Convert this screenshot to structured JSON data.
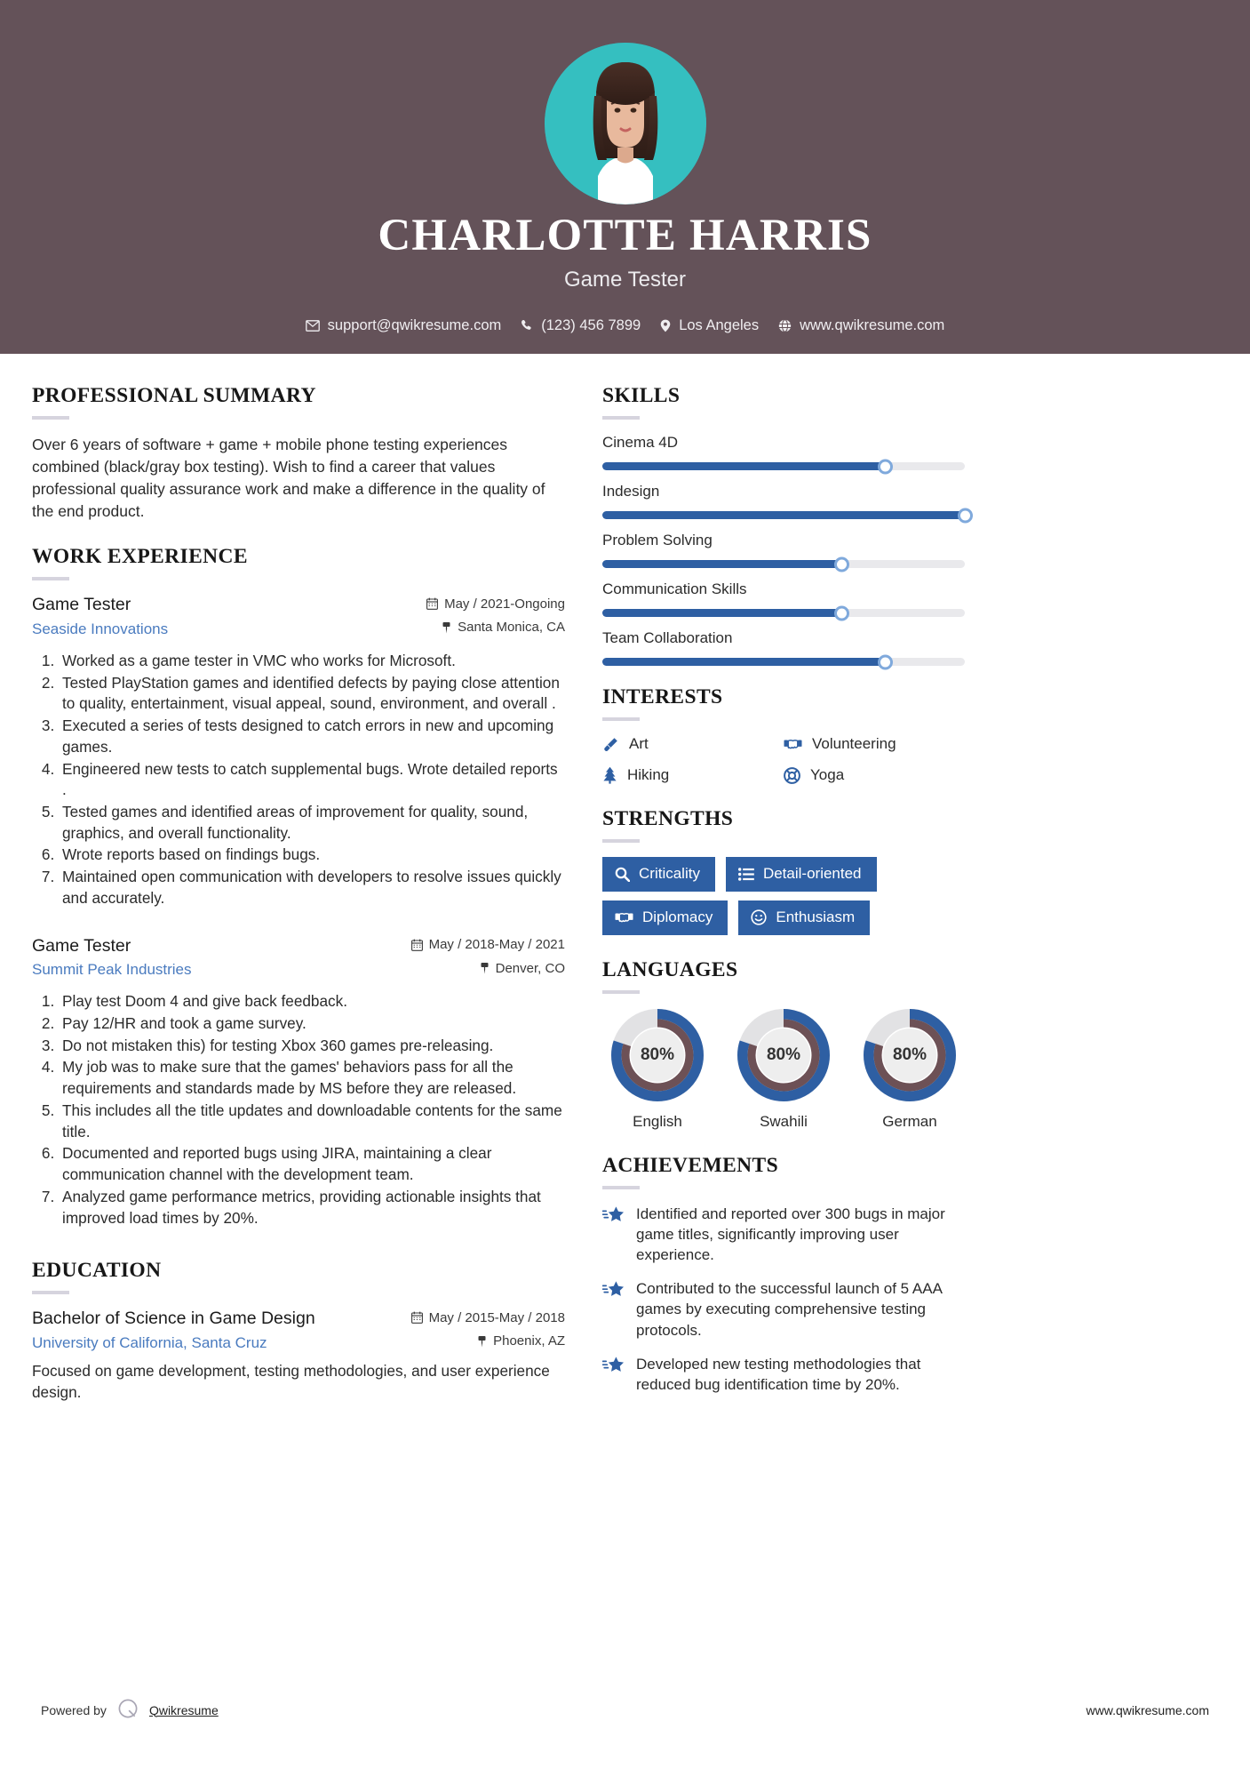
{
  "header": {
    "name": "CHARLOTTE HARRIS",
    "role": "Game Tester",
    "avatar_bg": "#35BFC0",
    "bg_color": "#645259",
    "contacts": [
      {
        "icon": "envelope-icon",
        "text": "support@qwikresume.com"
      },
      {
        "icon": "phone-icon",
        "text": "(123) 456 7899"
      },
      {
        "icon": "location-pin-icon",
        "text": "Los Angeles"
      },
      {
        "icon": "globe-icon",
        "text": "www.qwikresume.com"
      }
    ]
  },
  "summary": {
    "title": "PROFESSIONAL SUMMARY",
    "text": "Over 6 years of software + game + mobile phone testing experiences combined (black/gray box testing). Wish to find a career that values professional quality assurance work and make a difference in the quality of the end product."
  },
  "work": {
    "title": "WORK EXPERIENCE",
    "jobs": [
      {
        "title": "Game Tester",
        "org": "Seaside Innovations",
        "dates": "May / 2021-Ongoing",
        "location": "Santa Monica, CA",
        "bullets": [
          "Worked as a game tester in VMC who works for Microsoft.",
          "Tested PlayStation games and identified defects by paying close attention to quality, entertainment, visual appeal, sound, environment, and overall .",
          "Executed a series of tests designed to catch errors in new and upcoming games.",
          "Engineered new tests to catch supplemental bugs. Wrote detailed reports .",
          "Tested games and identified areas of improvement for quality, sound, graphics, and overall functionality.",
          "Wrote reports based on findings bugs.",
          "Maintained open communication with developers to resolve issues quickly and accurately."
        ]
      },
      {
        "title": "Game Tester",
        "org": "Summit Peak Industries",
        "dates": "May / 2018-May / 2021",
        "location": "Denver, CO",
        "bullets": [
          "Play test Doom 4 and give back feedback.",
          "Pay 12/HR and took a game survey.",
          "Do not mistaken this) for testing Xbox 360 games pre-releasing.",
          "My job was to make sure that the games' behaviors pass for all the requirements and standards made by MS before they are released.",
          "This includes all the title updates and downloadable contents for the same title.",
          "Documented and reported bugs using JIRA, maintaining a clear communication channel with the development team.",
          "Analyzed game performance metrics, providing actionable insights that improved load times by 20%."
        ]
      }
    ]
  },
  "education": {
    "title": "EDUCATION",
    "entries": [
      {
        "degree": "Bachelor of Science in Game Design",
        "school": "University of California, Santa Cruz",
        "dates": "May / 2015-May / 2018",
        "location": "Phoenix, AZ",
        "description": "Focused on game development, testing methodologies, and user experience design."
      }
    ]
  },
  "skills": {
    "title": "SKILLS",
    "accent_color": "#2E5FA3",
    "items": [
      {
        "name": "Cinema 4D",
        "percent": 78
      },
      {
        "name": "Indesign",
        "percent": 100
      },
      {
        "name": "Problem Solving",
        "percent": 66
      },
      {
        "name": "Communication Skills",
        "percent": 66
      },
      {
        "name": "Team Collaboration",
        "percent": 78
      }
    ]
  },
  "interests": {
    "title": "INTERESTS",
    "items": [
      {
        "label": "Art",
        "icon": "paintbrush-icon"
      },
      {
        "label": "Volunteering",
        "icon": "handshake-icon"
      },
      {
        "label": "Hiking",
        "icon": "pine-tree-icon"
      },
      {
        "label": "Yoga",
        "icon": "lifebuoy-icon"
      }
    ]
  },
  "strengths": {
    "title": "STRENGTHS",
    "items": [
      {
        "label": "Criticality",
        "icon": "magnifier-icon"
      },
      {
        "label": "Detail-oriented",
        "icon": "list-icon"
      },
      {
        "label": "Diplomacy",
        "icon": "handshake-icon"
      },
      {
        "label": "Enthusiasm",
        "icon": "smiley-icon"
      }
    ]
  },
  "languages": {
    "title": "LANGUAGES",
    "items": [
      {
        "name": "English",
        "percent": 80,
        "label": "80%"
      },
      {
        "name": "Swahili",
        "percent": 80,
        "label": "80%"
      },
      {
        "name": "German",
        "percent": 80,
        "label": "80%"
      }
    ]
  },
  "achievements": {
    "title": "ACHIEVEMENTS",
    "items": [
      "Identified and reported over 300 bugs in major game titles, significantly improving user experience.",
      "Contributed to the successful launch of 5 AAA games by executing comprehensive testing protocols.",
      "Developed new testing methodologies that reduced bug identification time by 20%."
    ]
  },
  "footer": {
    "powered_by": "Powered by",
    "brand": "Qwikresume",
    "url": "www.qwikresume.com"
  }
}
